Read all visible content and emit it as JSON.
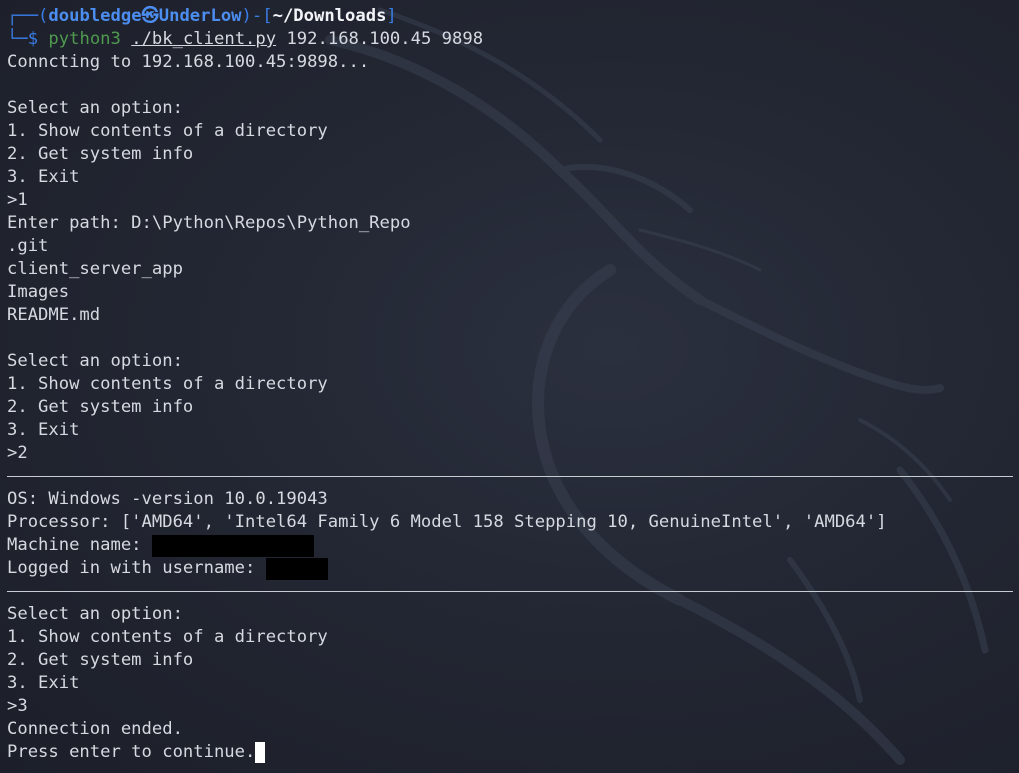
{
  "prompt": {
    "corner_top": "┌──(",
    "user": "doubledge",
    "at": "㉿",
    "host": "UnderLow",
    "mid": ")-[",
    "path": "~/Downloads",
    "close": "]",
    "corner_bottom": "└─",
    "dollar": "$",
    "command": "python3",
    "script_arg": "./bk_client.py",
    "args": "192.168.100.45 9898"
  },
  "output": {
    "connecting": "Conncting to 192.168.100.45:9898...",
    "menu_title": "Select an option:",
    "menu_opt1": "1. Show contents of a directory",
    "menu_opt2": "2. Get system info",
    "menu_opt3": "3. Exit",
    "choice1": ">1",
    "enter_path": "Enter path: D:\\Python\\Repos\\Python_Repo",
    "dir_entries": [
      ".git",
      "client_server_app",
      "Images",
      "README.md"
    ],
    "choice2": ">2",
    "os_line": "OS: Windows -version 10.0.19043",
    "processor_line": "Processor: ['AMD64', 'Intel64 Family 6 Model 158 Stepping 10, GenuineIntel', 'AMD64']",
    "machine_label": "Machine name: ",
    "user_label": "Logged in with username: ",
    "choice3": ">3",
    "conn_ended": "Connection ended.",
    "press_enter": "Press enter to continue."
  },
  "colors": {
    "background": "#232733",
    "text": "#d6d9e0",
    "prompt_frame": "#3a7ce6",
    "command": "#4f9a4f",
    "redaction": "#000000"
  }
}
